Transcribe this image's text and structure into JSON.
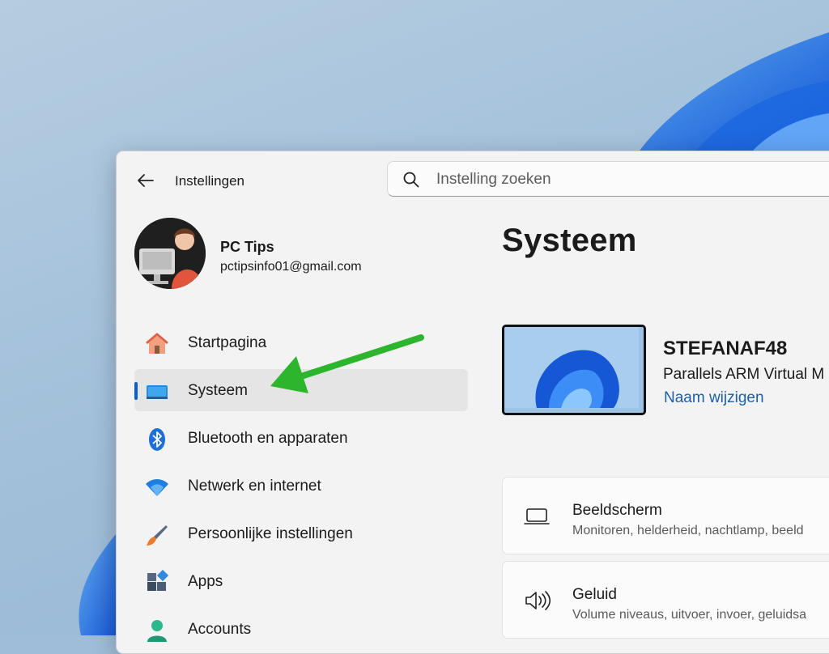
{
  "window": {
    "title": "Instellingen"
  },
  "search": {
    "placeholder": "Instelling zoeken"
  },
  "user": {
    "name": "PC Tips",
    "email": "pctipsinfo01@gmail.com"
  },
  "nav": {
    "items": [
      {
        "label": "Startpagina",
        "icon": "home-icon"
      },
      {
        "label": "Systeem",
        "icon": "system-icon",
        "active": true
      },
      {
        "label": "Bluetooth en apparaten",
        "icon": "bluetooth-icon"
      },
      {
        "label": "Netwerk en internet",
        "icon": "wifi-icon"
      },
      {
        "label": "Persoonlijke instellingen",
        "icon": "paintbrush-icon"
      },
      {
        "label": "Apps",
        "icon": "apps-icon"
      },
      {
        "label": "Accounts",
        "icon": "account-icon"
      }
    ]
  },
  "main": {
    "title": "Systeem",
    "device": {
      "name": "STEFANAF48",
      "model": "Parallels ARM Virtual M",
      "rename": "Naam wijzigen"
    },
    "cards": [
      {
        "title": "Beeldscherm",
        "subtitle": "Monitoren, helderheid, nachtlamp, beeld",
        "icon": "monitor-icon"
      },
      {
        "title": "Geluid",
        "subtitle": "Volume niveaus, uitvoer, invoer, geluidsa",
        "icon": "speaker-icon"
      }
    ]
  },
  "colors": {
    "accent": "#0f5fc0",
    "link": "#1a5fa8",
    "annotation_arrow": "#2db52d"
  }
}
